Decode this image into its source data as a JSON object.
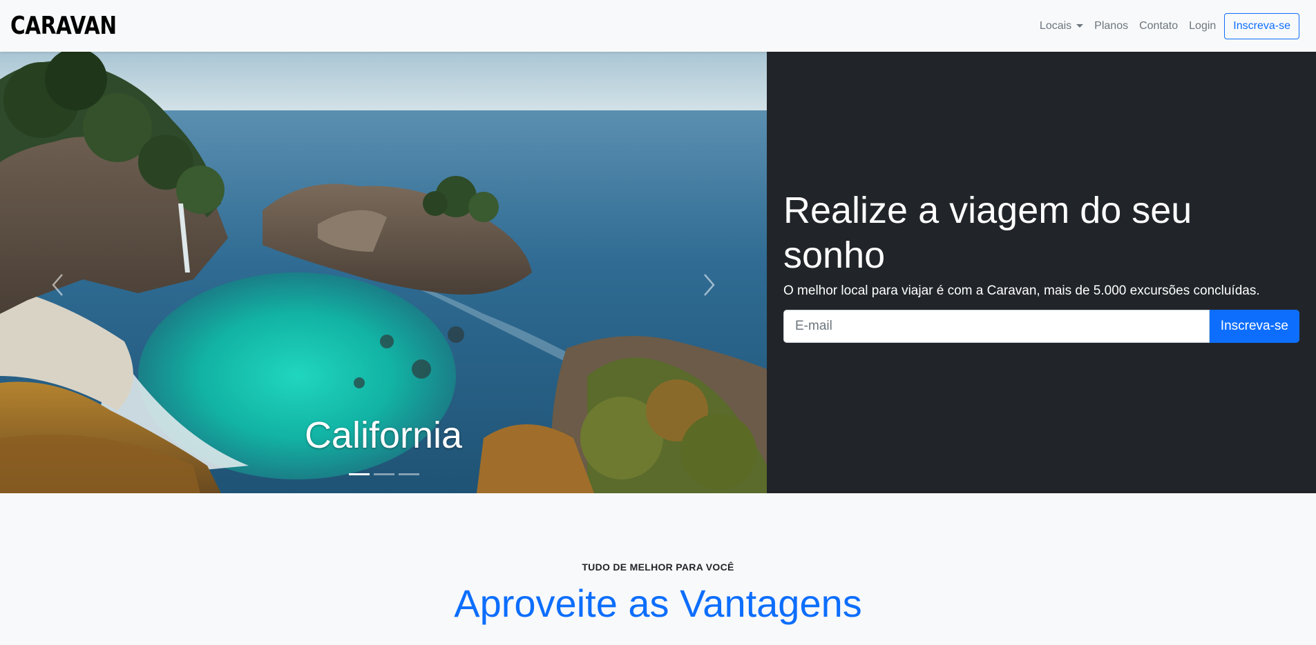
{
  "brand": "CARAVAN",
  "nav": {
    "locais": "Locais",
    "planos": "Planos",
    "contato": "Contato",
    "login": "Login",
    "signup": "Inscreva-se"
  },
  "carousel": {
    "caption": "California",
    "slide_count": 3,
    "active_slide": 1
  },
  "hero": {
    "title": "Realize a viagem do seu sonho",
    "subtitle": "O melhor local para viajar é com a Caravan, mais de 5.000 excursões concluídas.",
    "email_placeholder": "E-mail",
    "button": "Inscreva-se"
  },
  "section": {
    "eyebrow": "TUDO DE MELHOR PARA VOCÊ",
    "title": "Aproveite as Vantagens"
  },
  "colors": {
    "primary": "#0d6efd",
    "dark": "#212529",
    "light": "#f8f9fa"
  }
}
